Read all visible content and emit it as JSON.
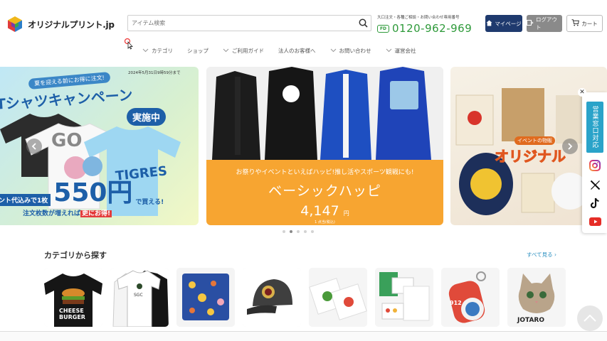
{
  "header": {
    "logo_text": "オリジナルプリント.jp",
    "search_placeholder": "アイテム検索",
    "phone_note": "大口注文・各種ご相談・お問い合わせ専用番号",
    "phone_badge": "FD",
    "phone_number": "0120-962-969",
    "mypage_label": "マイページ",
    "login_label": "ログアウト",
    "cart_label": "カート"
  },
  "nav": {
    "items": [
      {
        "label": "カテゴリ",
        "has_chevron": true
      },
      {
        "label": "ショップ",
        "has_chevron": false
      },
      {
        "label": "ご利用ガイド",
        "has_chevron": true
      },
      {
        "label": "法人のお客様へ",
        "has_chevron": false
      },
      {
        "label": "お問い合わせ",
        "has_chevron": true
      },
      {
        "label": "運営会社",
        "has_chevron": true
      }
    ]
  },
  "slider": {
    "left": {
      "date": "2024年5月31日9時59分まで",
      "lead": "夏を迎える前にお得に注文!",
      "title": "Tシャツキャンペーン",
      "badge": "実施中",
      "price_prefix": "ント代込みで1枚",
      "price": "550円",
      "price_suffix": "で買える!",
      "note_prefix": "注文枚数が増えれば",
      "note_highlight": "更にお得!"
    },
    "center": {
      "subtitle": "お祭りやイベントといえばハッピ!推し活やスポーツ観戦にも!",
      "title": "ベーシックハッピ",
      "price": "4,147",
      "price_unit": "円",
      "tax_note": "1 点当(税込)"
    },
    "right": {
      "event": "イベントの物販",
      "title": "オリジナル"
    },
    "dots_count": 5,
    "active_dot": 1
  },
  "side": {
    "tab_label": "営業窓口対応",
    "sns": [
      "instagram-icon",
      "x-icon",
      "tiktok-icon",
      "youtube-icon"
    ]
  },
  "categories": {
    "heading": "カテゴリから探す",
    "more_label": "すべて見る ›",
    "items": [
      {
        "name": "tshirt-burger",
        "bg": "#ffffff"
      },
      {
        "name": "polo-shirts",
        "bg": "#ffffff"
      },
      {
        "name": "towel-pattern",
        "bg": "#f4f4f4"
      },
      {
        "name": "cap",
        "bg": "#ffffff"
      },
      {
        "name": "food-bags",
        "bg": "#f5f5f5"
      },
      {
        "name": "goods-set",
        "bg": "#f5f5f5"
      },
      {
        "name": "keychain",
        "bg": "#f5f5f5"
      },
      {
        "name": "cat-sticker",
        "bg": "#f5f5f5"
      }
    ]
  },
  "colors": {
    "brand_navy": "#1f3a6e",
    "phone_green": "#2e9a3a",
    "band_orange": "#f7a531",
    "side_tab": "#2aa3c9",
    "link_blue": "#2a8fc0"
  }
}
